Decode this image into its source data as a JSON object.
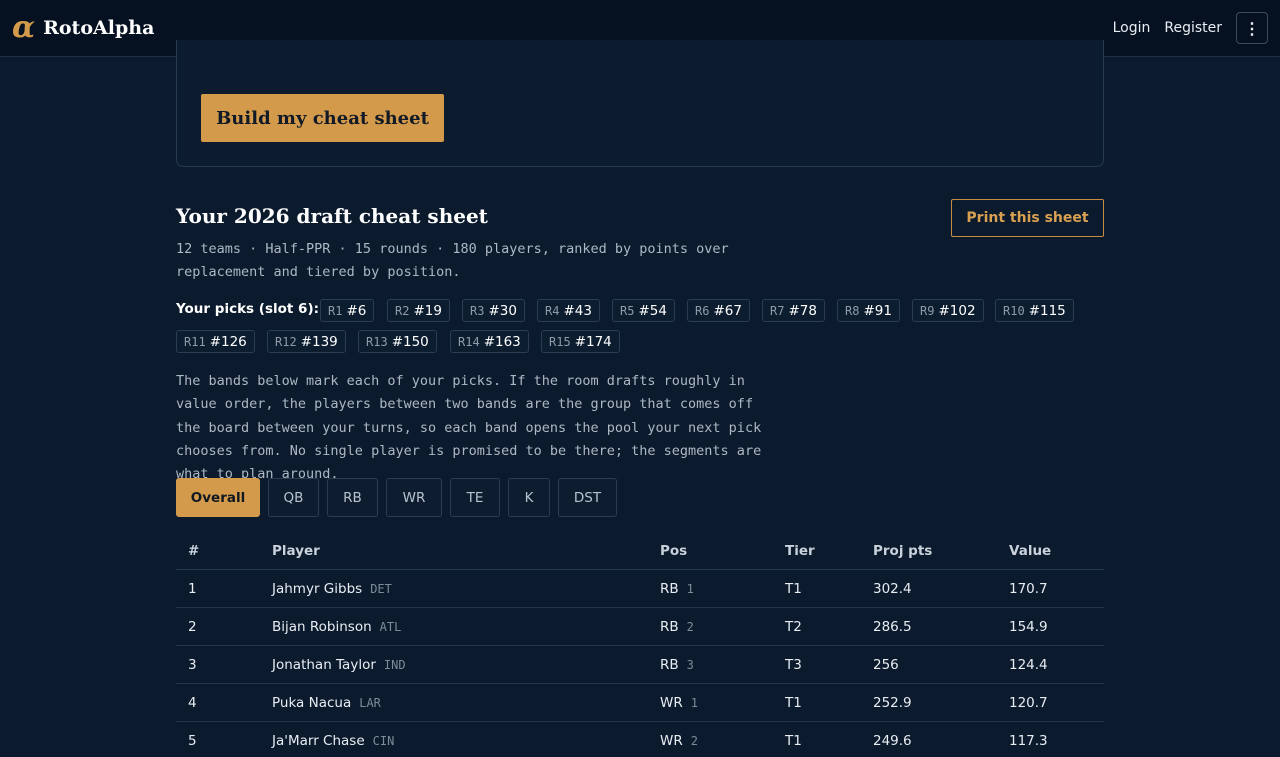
{
  "header": {
    "logo_mark": "α",
    "logo_text": "RotoAlpha",
    "login": "Login",
    "register": "Register",
    "menu_icon": "⋮"
  },
  "builder": {
    "button_label": "Build my cheat sheet"
  },
  "sheet": {
    "title": "Your 2026 draft cheat sheet",
    "print_label": "Print this sheet",
    "subtitle": "12 teams · Half-PPR · 15 rounds · 180 players, ranked by points over replacement and tiered by position.",
    "picks_label": "Your picks (slot 6):",
    "picks": [
      {
        "round": "R1",
        "pick": "#6"
      },
      {
        "round": "R2",
        "pick": "#19"
      },
      {
        "round": "R3",
        "pick": "#30"
      },
      {
        "round": "R4",
        "pick": "#43"
      },
      {
        "round": "R5",
        "pick": "#54"
      },
      {
        "round": "R6",
        "pick": "#67"
      },
      {
        "round": "R7",
        "pick": "#78"
      },
      {
        "round": "R8",
        "pick": "#91"
      },
      {
        "round": "R9",
        "pick": "#102"
      },
      {
        "round": "R10",
        "pick": "#115"
      },
      {
        "round": "R11",
        "pick": "#126"
      },
      {
        "round": "R12",
        "pick": "#139"
      },
      {
        "round": "R13",
        "pick": "#150"
      },
      {
        "round": "R14",
        "pick": "#163"
      },
      {
        "round": "R15",
        "pick": "#174"
      }
    ],
    "explanation": "The bands below mark each of your picks. If the room drafts roughly in value order, the players between two bands are the group that comes off the board between your turns, so each band opens the pool your next pick chooses from. No single player is promised to be there; the segments are what to plan around."
  },
  "tabs": [
    {
      "label": "Overall",
      "active": true
    },
    {
      "label": "QB"
    },
    {
      "label": "RB"
    },
    {
      "label": "WR"
    },
    {
      "label": "TE"
    },
    {
      "label": "K"
    },
    {
      "label": "DST"
    }
  ],
  "table": {
    "headers": [
      "#",
      "Player",
      "Pos",
      "Tier",
      "Proj pts",
      "Value"
    ],
    "rows": [
      {
        "rank": "1",
        "player": "Jahmyr Gibbs",
        "team": "DET",
        "pos": "RB",
        "pos_rank": "1",
        "tier": "T1",
        "proj": "302.4",
        "value": "170.7"
      },
      {
        "rank": "2",
        "player": "Bijan Robinson",
        "team": "ATL",
        "pos": "RB",
        "pos_rank": "2",
        "tier": "T2",
        "proj": "286.5",
        "value": "154.9"
      },
      {
        "rank": "3",
        "player": "Jonathan Taylor",
        "team": "IND",
        "pos": "RB",
        "pos_rank": "3",
        "tier": "T3",
        "proj": "256",
        "value": "124.4"
      },
      {
        "rank": "4",
        "player": "Puka Nacua",
        "team": "LAR",
        "pos": "WR",
        "pos_rank": "1",
        "tier": "T1",
        "proj": "252.9",
        "value": "120.7"
      },
      {
        "rank": "5",
        "player": "Ja'Marr Chase",
        "team": "CIN",
        "pos": "WR",
        "pos_rank": "2",
        "tier": "T1",
        "proj": "249.6",
        "value": "117.3"
      }
    ]
  }
}
